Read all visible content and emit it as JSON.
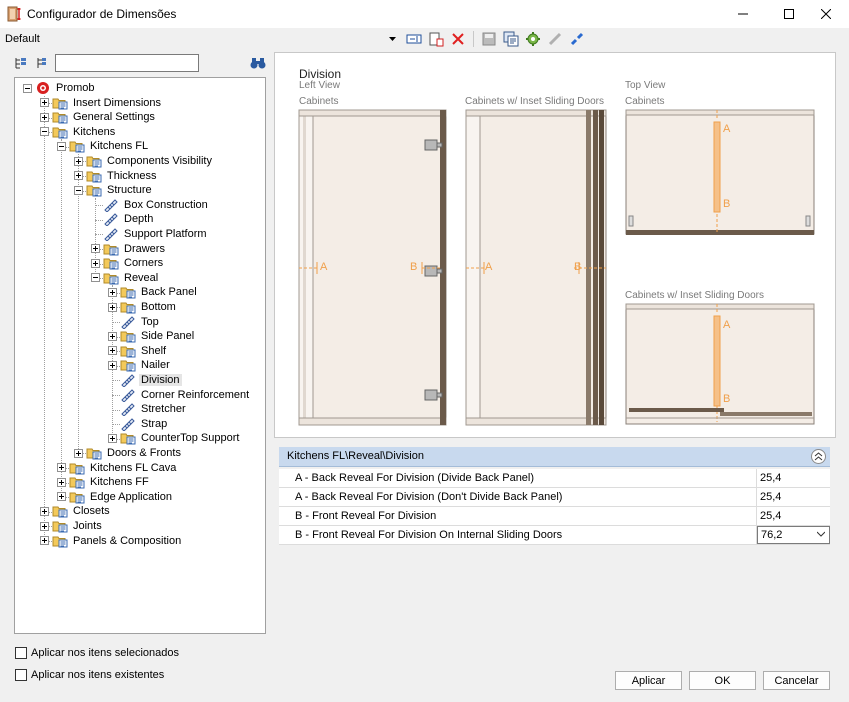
{
  "window": {
    "title": "Configurador de Dimensões",
    "controls": {
      "minimize": "—",
      "maximize": "☐",
      "close": "✕"
    }
  },
  "profile": {
    "label": "Default"
  },
  "toolbar": {
    "icons": [
      "dropdown-arrow-icon",
      "rename-icon",
      "new-item-icon",
      "delete-icon",
      "save-icon",
      "copy-icon",
      "settings-icon",
      "link-icon",
      "unlink-icon"
    ]
  },
  "search": {
    "value": ""
  },
  "tree": {
    "items": [
      {
        "label": "Promob",
        "level": 0,
        "exp": "minus",
        "icon": "root"
      },
      {
        "label": "Insert Dimensions",
        "level": 1,
        "exp": "plus",
        "icon": "folder"
      },
      {
        "label": "General Settings",
        "level": 1,
        "exp": "plus",
        "icon": "folder"
      },
      {
        "label": "Kitchens",
        "level": 1,
        "exp": "minus",
        "icon": "folder"
      },
      {
        "label": "Kitchens FL",
        "level": 2,
        "exp": "minus",
        "icon": "folder"
      },
      {
        "label": "Components Visibility",
        "level": 3,
        "exp": "plus",
        "icon": "folder"
      },
      {
        "label": "Thickness",
        "level": 3,
        "exp": "plus",
        "icon": "folder"
      },
      {
        "label": "Structure",
        "level": 3,
        "exp": "minus",
        "icon": "folder"
      },
      {
        "label": "Box Construction",
        "level": 4,
        "exp": "none",
        "icon": "leaf"
      },
      {
        "label": "Depth",
        "level": 4,
        "exp": "none",
        "icon": "leaf"
      },
      {
        "label": "Support Platform",
        "level": 4,
        "exp": "none",
        "icon": "leaf"
      },
      {
        "label": "Drawers",
        "level": 4,
        "exp": "plus",
        "icon": "folder"
      },
      {
        "label": "Corners",
        "level": 4,
        "exp": "plus",
        "icon": "folder"
      },
      {
        "label": "Reveal",
        "level": 4,
        "exp": "minus",
        "icon": "folder"
      },
      {
        "label": "Back Panel",
        "level": 5,
        "exp": "plus",
        "icon": "folder"
      },
      {
        "label": "Bottom",
        "level": 5,
        "exp": "plus",
        "icon": "folder"
      },
      {
        "label": "Top",
        "level": 5,
        "exp": "none",
        "icon": "leaf"
      },
      {
        "label": "Side Panel",
        "level": 5,
        "exp": "plus",
        "icon": "folder"
      },
      {
        "label": "Shelf",
        "level": 5,
        "exp": "plus",
        "icon": "folder"
      },
      {
        "label": "Nailer",
        "level": 5,
        "exp": "plus",
        "icon": "folder"
      },
      {
        "label": "Division",
        "level": 5,
        "exp": "none",
        "icon": "leaf",
        "selected": true
      },
      {
        "label": "Corner Reinforcement",
        "level": 5,
        "exp": "none",
        "icon": "leaf"
      },
      {
        "label": "Stretcher",
        "level": 5,
        "exp": "none",
        "icon": "leaf"
      },
      {
        "label": "Strap",
        "level": 5,
        "exp": "none",
        "icon": "leaf"
      },
      {
        "label": "CounterTop Support",
        "level": 5,
        "exp": "plus",
        "icon": "folder"
      },
      {
        "label": "Doors & Fronts",
        "level": 3,
        "exp": "plus",
        "icon": "folder"
      },
      {
        "label": "Kitchens FL Cava",
        "level": 2,
        "exp": "plus",
        "icon": "folder"
      },
      {
        "label": "Kitchens FF",
        "level": 2,
        "exp": "plus",
        "icon": "folder"
      },
      {
        "label": "Edge Application",
        "level": 2,
        "exp": "plus",
        "icon": "folder"
      },
      {
        "label": "Closets",
        "level": 1,
        "exp": "plus",
        "icon": "folder"
      },
      {
        "label": "Joints",
        "level": 1,
        "exp": "plus",
        "icon": "folder"
      },
      {
        "label": "Panels & Composition",
        "level": 1,
        "exp": "plus",
        "icon": "folder"
      }
    ]
  },
  "preview": {
    "title": "Division",
    "left_view": "Left View",
    "top_view": "Top View",
    "cabinets": "Cabinets",
    "cabinets_inset": "Cabinets w/ Inset Sliding Doors",
    "marker_a": "A",
    "marker_b": "B"
  },
  "properties": {
    "path": "Kitchens FL\\Reveal\\Division",
    "rows": [
      {
        "name": "A - Back Reveal For Division (Divide Back Panel)",
        "value": "25,4"
      },
      {
        "name": "A - Back Reveal For Division (Don't Divide Back Panel)",
        "value": "25,4"
      },
      {
        "name": "B - Front Reveal For Division",
        "value": "25,4"
      },
      {
        "name": "B - Front Reveal For Division On Internal Sliding Doors",
        "value": "76,2",
        "combo": true
      }
    ]
  },
  "options": {
    "apply_selected": "Aplicar nos itens selecionados",
    "apply_existing": "Aplicar nos itens existentes"
  },
  "buttons": {
    "apply": "Aplicar",
    "ok": "OK",
    "cancel": "Cancelar"
  },
  "colors": {
    "accent_orange": "#f0a04b",
    "wood_dark": "#6b5a4a",
    "panel_fill": "#f4ede6",
    "header_blue": "#c8d9ee"
  }
}
